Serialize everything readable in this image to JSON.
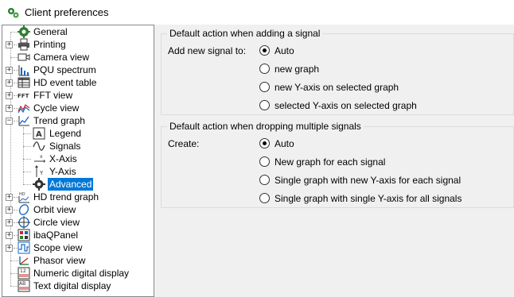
{
  "window": {
    "title": "Client preferences",
    "icon": "gears-icon"
  },
  "tree": [
    {
      "label": "General",
      "icon": "gear-green-icon"
    },
    {
      "label": "Printing",
      "icon": "printer-icon"
    },
    {
      "label": "Camera view",
      "icon": "camera-icon"
    },
    {
      "label": "PQU spectrum",
      "icon": "spectrum-icon"
    },
    {
      "label": "HD event table",
      "icon": "table-icon"
    },
    {
      "label": "FFT view",
      "icon": "fft-icon"
    },
    {
      "label": "Cycle view",
      "icon": "cycle-icon"
    },
    {
      "label": "Trend graph",
      "icon": "trend-graph-icon"
    },
    {
      "label": "Legend",
      "icon": "legend-icon"
    },
    {
      "label": "Signals",
      "icon": "signals-icon"
    },
    {
      "label": "X-Axis",
      "icon": "x-axis-icon"
    },
    {
      "label": "Y-Axis",
      "icon": "y-axis-icon"
    },
    {
      "label": "Advanced",
      "icon": "gear-icon"
    },
    {
      "label": "HD trend graph",
      "icon": "hd-trend-icon"
    },
    {
      "label": "Orbit view",
      "icon": "orbit-icon"
    },
    {
      "label": "Circle view",
      "icon": "circle-view-icon"
    },
    {
      "label": "ibaQPanel",
      "icon": "qpanel-icon"
    },
    {
      "label": "Scope view",
      "icon": "scope-icon"
    },
    {
      "label": "Phasor view",
      "icon": "phasor-icon"
    },
    {
      "label": "Numeric digital display",
      "icon": "numeric-display-icon"
    },
    {
      "label": "Text digital display",
      "icon": "text-display-icon"
    }
  ],
  "adding": {
    "title": "Default action when adding a signal",
    "field_label": "Add new signal to:",
    "options": [
      "Auto",
      "new graph",
      "new Y-axis on selected graph",
      "selected Y-axis on selected graph"
    ],
    "selected": "Auto"
  },
  "dropping": {
    "title": "Default action when dropping multiple signals",
    "field_label": "Create:",
    "options": [
      "Auto",
      "New graph for each signal",
      "Single graph with new Y-axis for each signal",
      "Single graph with single Y-axis for all signals"
    ],
    "selected": "Auto"
  },
  "colors": {
    "selection": "#0078d7",
    "panel": "#f0f0f0"
  }
}
